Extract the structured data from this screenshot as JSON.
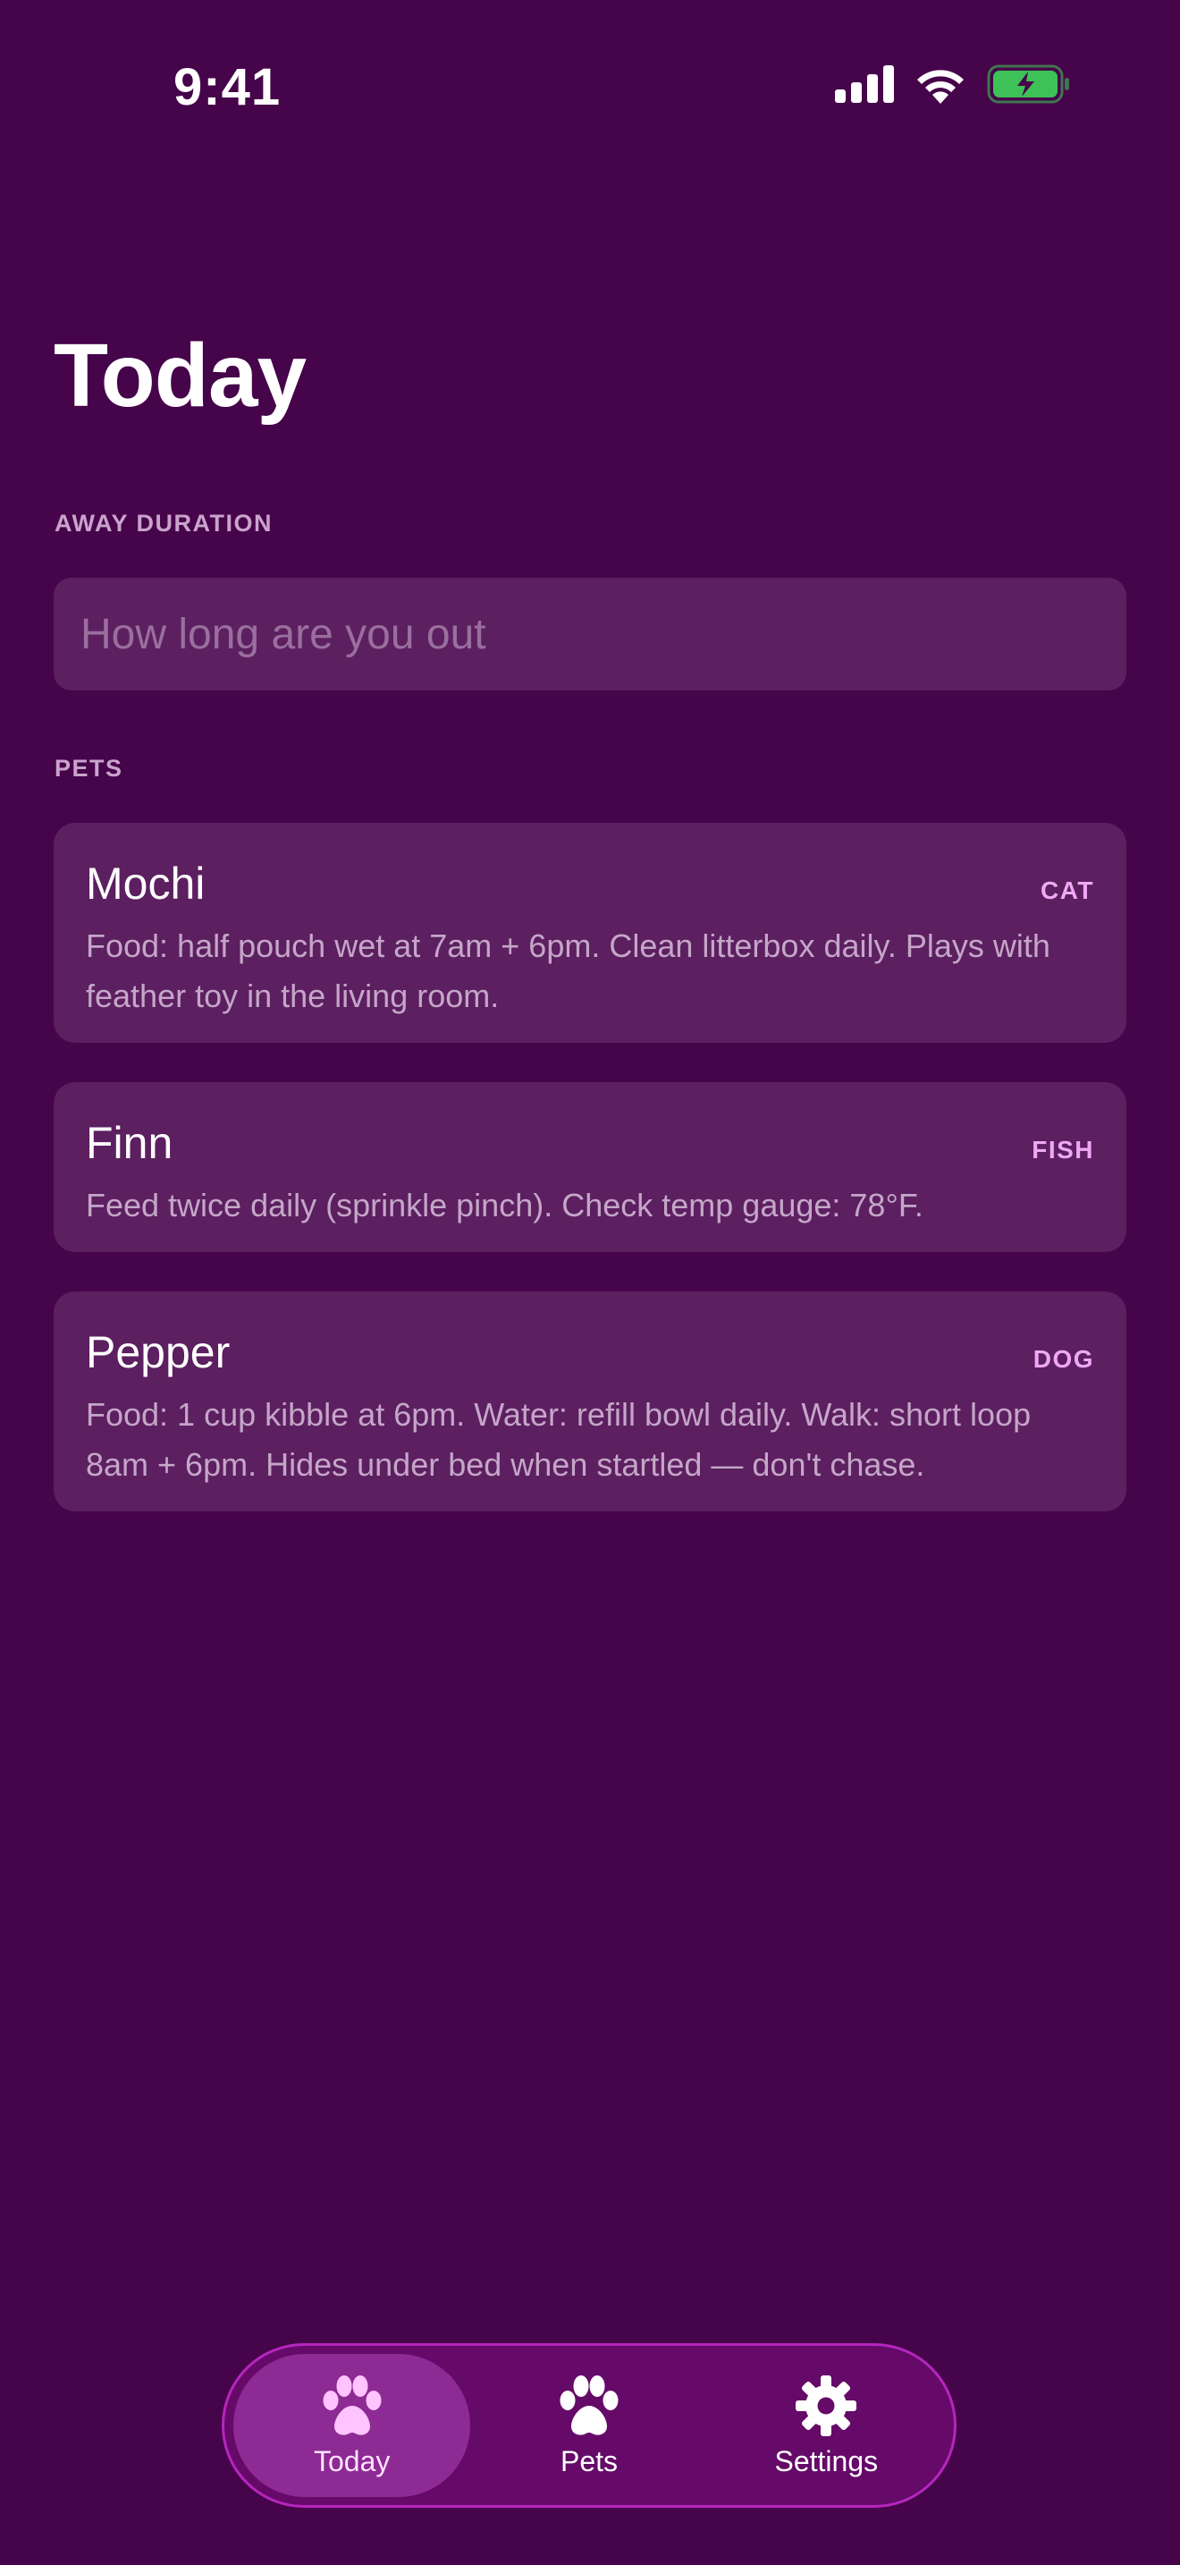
{
  "status_bar": {
    "time": "9:41",
    "icons": [
      "signal-icon",
      "wifi-icon",
      "battery-charging-icon"
    ],
    "battery_color": "#3ec157"
  },
  "page": {
    "title": "Today"
  },
  "away": {
    "section_label": "AWAY DURATION",
    "input_value": "",
    "placeholder": "How long are you out"
  },
  "pets": {
    "section_label": "PETS",
    "items": [
      {
        "name": "Mochi",
        "type": "CAT",
        "notes": "Food: half pouch wet at 7am + 6pm. Clean litterbox daily. Plays with feather toy in the living room."
      },
      {
        "name": "Finn",
        "type": "FISH",
        "notes": "Feed twice daily (sprinkle pinch). Check temp gauge: 78°F."
      },
      {
        "name": "Pepper",
        "type": "DOG",
        "notes": "Food: 1 cup kibble at 6pm. Water: refill bowl daily. Walk: short loop 8am + 6pm. Hides under bed when startled — don't chase."
      }
    ]
  },
  "tab_bar": {
    "tabs": [
      {
        "label": "Today",
        "icon": "paw-icon",
        "active": true
      },
      {
        "label": "Pets",
        "icon": "paw-icon",
        "active": false
      },
      {
        "label": "Settings",
        "icon": "gear-icon",
        "active": false
      }
    ]
  },
  "colors": {
    "background": "#46044a",
    "card": "#5c1f60",
    "accent": "#f0a8f4",
    "tab_bar": "#650a69",
    "tab_active": "#8e2a94"
  }
}
